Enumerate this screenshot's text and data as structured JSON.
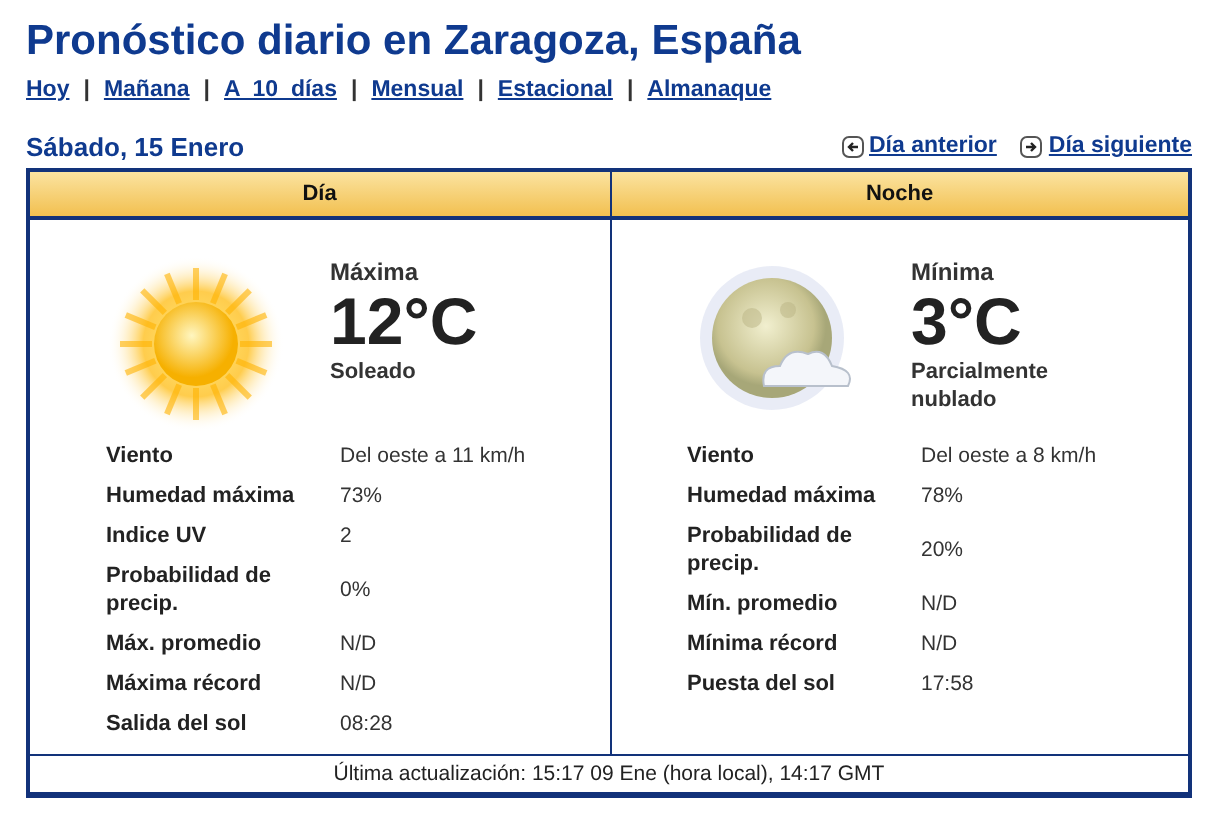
{
  "title": "Pronóstico diario en Zaragoza, España",
  "nav": {
    "separator": "|",
    "links": [
      "Hoy",
      "Mañana",
      "A  10  días",
      "Mensual",
      "Estacional",
      "Almanaque"
    ]
  },
  "date": "Sábado, 15 Enero",
  "pager": [
    {
      "kind": "prev",
      "label": "Día anterior"
    },
    {
      "kind": "next",
      "label": "Día siguiente"
    }
  ],
  "panels": [
    {
      "header": "Día",
      "kind": "day",
      "temp_label": "Máxima",
      "temp": "12°C",
      "condition": "Soleado",
      "details": [
        {
          "label": "Viento",
          "value": "Del oeste a 11 km/h"
        },
        {
          "label": "Humedad máxima",
          "value": "73%"
        },
        {
          "label": "Indice UV",
          "value": "2"
        },
        {
          "label": "Probabilidad de precip.",
          "value": "0%"
        },
        {
          "label": "Máx. promedio",
          "value": "N/D"
        },
        {
          "label": "Máxima récord",
          "value": "N/D"
        },
        {
          "label": "Salida del sol",
          "value": "08:28"
        }
      ]
    },
    {
      "header": "Noche",
      "kind": "night",
      "temp_label": "Mínima",
      "temp": "3°C",
      "condition": "Parcialmente nublado",
      "details": [
        {
          "label": "Viento",
          "value": "Del oeste a 8 km/h"
        },
        {
          "label": "Humedad máxima",
          "value": "78%"
        },
        {
          "label": "Probabilidad de precip.",
          "value": "20%"
        },
        {
          "label": "Mín. promedio",
          "value": "N/D"
        },
        {
          "label": "Mínima récord",
          "value": "N/D"
        },
        {
          "label": "Puesta del sol",
          "value": "17:58"
        }
      ]
    }
  ],
  "footer": "Última actualización: 15:17 09 Ene (hora local), 14:17 GMT"
}
